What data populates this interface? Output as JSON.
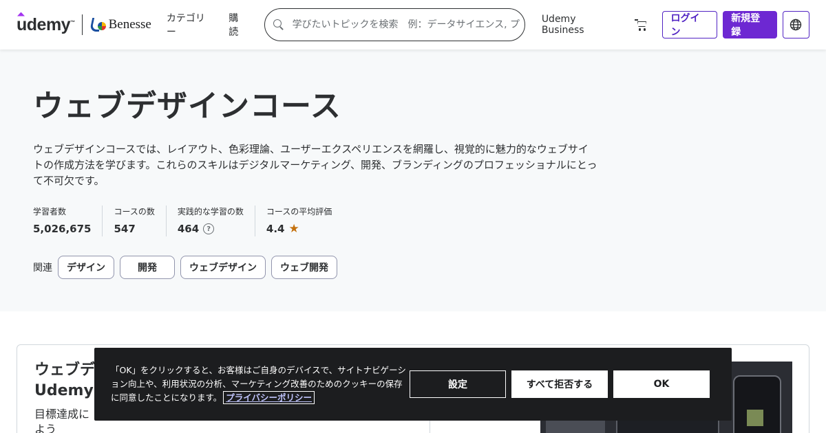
{
  "header": {
    "logo_text": "udemy",
    "logo_tm": "™",
    "partner": "Benesse",
    "nav": [
      "カテゴリー",
      "購読"
    ],
    "search_placeholder": "学びたいトピックを検索　例：データサイエンス, プログラミング",
    "business_link": "Udemy Business",
    "login_label": "ログイン",
    "signup_label": "新規登録"
  },
  "hero": {
    "title": "ウェブデザインコース",
    "description": "ウェブデザインコースでは、レイアウト、色彩理論、ユーザーエクスペリエンスを網羅し、視覚的に魅力的なウェブサイトの作成方法を学びます。これらのスキルはデジタルマーケティング、開発、ブランディングのプロフェッショナルにとって不可欠です。",
    "stats": [
      {
        "label": "学習者数",
        "value": "5,026,675"
      },
      {
        "label": "コースの数",
        "value": "547"
      },
      {
        "label": "実践的な学習の数",
        "value": "464"
      },
      {
        "label": "コースの平均評価",
        "value": "4.4"
      }
    ],
    "help_glyph": "?",
    "star_glyph": "★",
    "related_label": "関連",
    "related": [
      "デザイン",
      "開発",
      "ウェブデザイン",
      "ウェブ開発"
    ]
  },
  "card": {
    "title_line1": "ウェブデ",
    "title_line2": "Udemyに",
    "subtitle_line1": "目標達成に",
    "subtitle_line2": "よう"
  },
  "cookie": {
    "text": "「OK」をクリックすると、お客様はご自身のデバイスで、サイトナビゲーション向上や、利用状況の分析、マーケティング改善のためのクッキーの保存に同意したことになります。",
    "privacy_link": "プライバシーポリシー",
    "settings_label": "設定",
    "reject_label": "すべて拒否する",
    "ok_label": "OK"
  },
  "colors": {
    "brand_purple": "#6d28d2",
    "outline_purple": "#5022c3",
    "star": "#c4710d",
    "banner_bg": "#1c1d1f"
  }
}
